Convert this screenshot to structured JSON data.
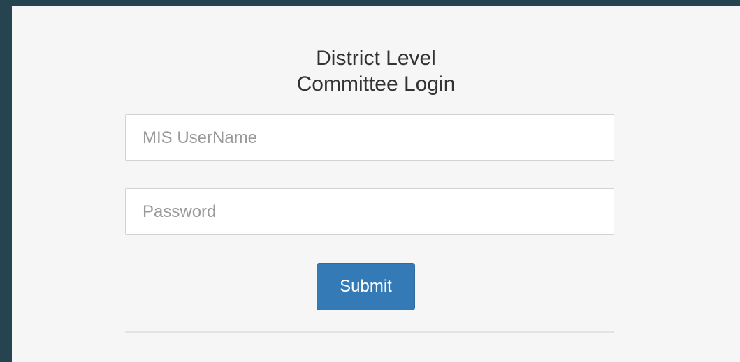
{
  "login": {
    "title_line1": "District Level",
    "title_line2": "Committee Login",
    "username_placeholder": "MIS UserName",
    "username_value": "",
    "password_placeholder": "Password",
    "password_value": "",
    "submit_label": "Submit"
  },
  "colors": {
    "background": "#25444f",
    "panel": "#f6f6f6",
    "accent": "#337ab7"
  }
}
